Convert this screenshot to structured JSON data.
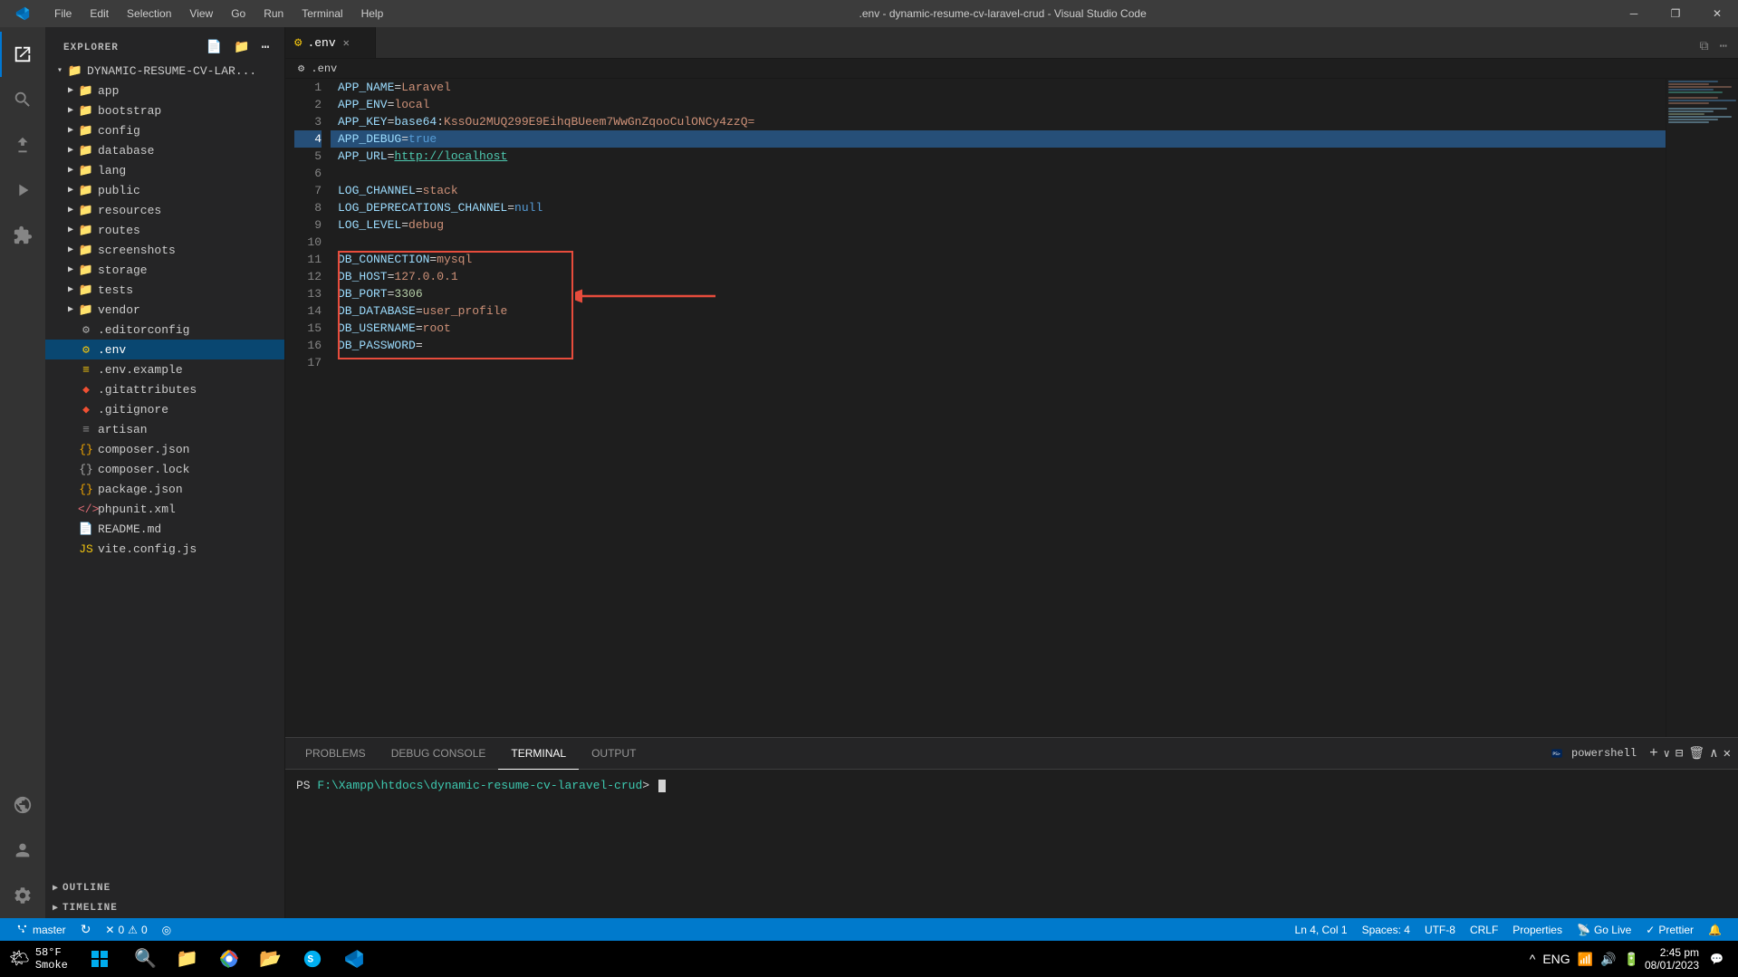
{
  "app": {
    "title": ".env - dynamic-resume-cv-laravel-crud - Visual Studio Code"
  },
  "titlebar": {
    "icon": "⬛",
    "menus": [
      "File",
      "Edit",
      "Selection",
      "View",
      "Go",
      "Run",
      "Terminal",
      "Help"
    ],
    "title": ".env - dynamic-resume-cv-laravel-crud - Visual Studio Code",
    "controls": [
      "—",
      "❐",
      "✕"
    ]
  },
  "activity_bar": {
    "items": [
      {
        "icon": "⎘",
        "name": "explorer",
        "active": true
      },
      {
        "icon": "🔍",
        "name": "search"
      },
      {
        "icon": "⑂",
        "name": "source-control"
      },
      {
        "icon": "▷",
        "name": "run-debug"
      },
      {
        "icon": "⊞",
        "name": "extensions"
      },
      {
        "icon": "⊟",
        "name": "remote-explorer"
      }
    ],
    "bottom": [
      {
        "icon": "⚙",
        "name": "settings"
      },
      {
        "icon": "👤",
        "name": "accounts"
      }
    ]
  },
  "sidebar": {
    "title": "EXPLORER",
    "header_actions": [
      "⬜",
      "⋯"
    ],
    "root_folder": "DYNAMIC-RESUME-CV-LAR...",
    "tree": [
      {
        "type": "folder",
        "name": "app",
        "indent": 1,
        "expanded": false
      },
      {
        "type": "folder",
        "name": "bootstrap",
        "indent": 1,
        "expanded": false
      },
      {
        "type": "folder",
        "name": "config",
        "indent": 1,
        "expanded": false
      },
      {
        "type": "folder",
        "name": "database",
        "indent": 1,
        "expanded": false
      },
      {
        "type": "folder",
        "name": "lang",
        "indent": 1,
        "expanded": false
      },
      {
        "type": "folder",
        "name": "public",
        "indent": 1,
        "expanded": false
      },
      {
        "type": "folder",
        "name": "resources",
        "indent": 1,
        "expanded": false
      },
      {
        "type": "folder",
        "name": "routes",
        "indent": 1,
        "expanded": false
      },
      {
        "type": "folder",
        "name": "screenshots",
        "indent": 1,
        "expanded": false
      },
      {
        "type": "folder",
        "name": "storage",
        "indent": 1,
        "expanded": false
      },
      {
        "type": "folder",
        "name": "tests",
        "indent": 1,
        "expanded": false
      },
      {
        "type": "folder",
        "name": "vendor",
        "indent": 1,
        "expanded": false
      },
      {
        "type": "file",
        "name": ".editorconfig",
        "indent": 1,
        "icon_type": "editorconfig"
      },
      {
        "type": "file",
        "name": ".env",
        "indent": 1,
        "icon_type": "env",
        "active": true
      },
      {
        "type": "file",
        "name": ".env.example",
        "indent": 1,
        "icon_type": "env"
      },
      {
        "type": "file",
        "name": ".gitattributes",
        "indent": 1,
        "icon_type": "git"
      },
      {
        "type": "file",
        "name": ".gitignore",
        "indent": 1,
        "icon_type": "git"
      },
      {
        "type": "file",
        "name": "artisan",
        "indent": 1,
        "icon_type": "php"
      },
      {
        "type": "file",
        "name": "composer.json",
        "indent": 1,
        "icon_type": "json"
      },
      {
        "type": "file",
        "name": "composer.lock",
        "indent": 1,
        "icon_type": "lock"
      },
      {
        "type": "file",
        "name": "package.json",
        "indent": 1,
        "icon_type": "json"
      },
      {
        "type": "file",
        "name": "phpunit.xml",
        "indent": 1,
        "icon_type": "xml"
      },
      {
        "type": "file",
        "name": "README.md",
        "indent": 1,
        "icon_type": "md"
      },
      {
        "type": "file",
        "name": "vite.config.js",
        "indent": 1,
        "icon_type": "js"
      }
    ],
    "outline_label": "OUTLINE",
    "timeline_label": "TIMELINE"
  },
  "tabs": [
    {
      "label": ".env",
      "icon": "⚙",
      "active": true,
      "closable": true
    }
  ],
  "breadcrumb": [
    ".env"
  ],
  "code": {
    "lines": [
      {
        "num": 1,
        "content": "APP_NAME=Laravel",
        "type": "app"
      },
      {
        "num": 2,
        "content": "APP_ENV=local",
        "type": "app"
      },
      {
        "num": 3,
        "content": "APP_KEY=base64:KssOu2MUQ299E9EihqBUeem7WwGnZqooCulONCy4zzQ=",
        "type": "app"
      },
      {
        "num": 4,
        "content": "APP_DEBUG=true",
        "type": "app"
      },
      {
        "num": 5,
        "content": "APP_URL=http://localhost",
        "type": "app"
      },
      {
        "num": 6,
        "content": "",
        "type": "empty"
      },
      {
        "num": 7,
        "content": "LOG_CHANNEL=stack",
        "type": "log"
      },
      {
        "num": 8,
        "content": "LOG_DEPRECATIONS_CHANNEL=null",
        "type": "log"
      },
      {
        "num": 9,
        "content": "LOG_LEVEL=debug",
        "type": "log"
      },
      {
        "num": 10,
        "content": "",
        "type": "empty"
      },
      {
        "num": 11,
        "content": "DB_CONNECTION=mysql",
        "type": "db",
        "highlighted": true
      },
      {
        "num": 12,
        "content": "DB_HOST=127.0.0.1",
        "type": "db",
        "highlighted": true
      },
      {
        "num": 13,
        "content": "DB_PORT=3306",
        "type": "db",
        "highlighted": true
      },
      {
        "num": 14,
        "content": "DB_DATABASE=user_profile",
        "type": "db",
        "highlighted": true
      },
      {
        "num": 15,
        "content": "DB_USERNAME=root",
        "type": "db",
        "highlighted": true
      },
      {
        "num": 16,
        "content": "DB_PASSWORD=",
        "type": "db",
        "highlighted": true
      },
      {
        "num": 17,
        "content": "",
        "type": "empty"
      }
    ]
  },
  "panel": {
    "tabs": [
      "PROBLEMS",
      "DEBUG CONSOLE",
      "TERMINAL",
      "OUTPUT"
    ],
    "active_tab": "TERMINAL",
    "terminal_type": "powershell",
    "terminal_content": "PS F:\\Xampp\\htdocs\\dynamic-resume-cv-laravel-crud>",
    "actions": [
      "+",
      "∨",
      "⊟",
      "⊠",
      "∧",
      "✕"
    ]
  },
  "status_bar": {
    "left": [
      {
        "icon": "⑂",
        "label": "master"
      },
      {
        "icon": "↻",
        "label": ""
      },
      {
        "icon": "⚠",
        "label": "0"
      },
      {
        "icon": "✕",
        "label": "0"
      },
      {
        "icon": "◎",
        "label": ""
      }
    ],
    "right": [
      {
        "label": "Ln 4, Col 1"
      },
      {
        "label": "Spaces: 4"
      },
      {
        "label": "UTF-8"
      },
      {
        "label": "CRLF"
      },
      {
        "label": "Properties"
      },
      {
        "icon": "📡",
        "label": "Go Live"
      },
      {
        "icon": "✓",
        "label": "Prettier"
      },
      {
        "icon": "🔔",
        "label": ""
      }
    ]
  },
  "taskbar": {
    "weather": {
      "temp": "58°F",
      "condition": "Smoke"
    },
    "items": [
      {
        "icon": "🪟",
        "name": "start"
      },
      {
        "icon": "🔍",
        "name": "search"
      },
      {
        "icon": "📁",
        "name": "file-explorer"
      },
      {
        "icon": "🌐",
        "name": "chrome"
      },
      {
        "icon": "📂",
        "name": "folder"
      },
      {
        "icon": "💬",
        "name": "skype"
      },
      {
        "icon": "💙",
        "name": "vscode"
      }
    ],
    "tray": {
      "time": "2:45 pm",
      "date": "08/01/2023",
      "lang": "ENG"
    }
  }
}
